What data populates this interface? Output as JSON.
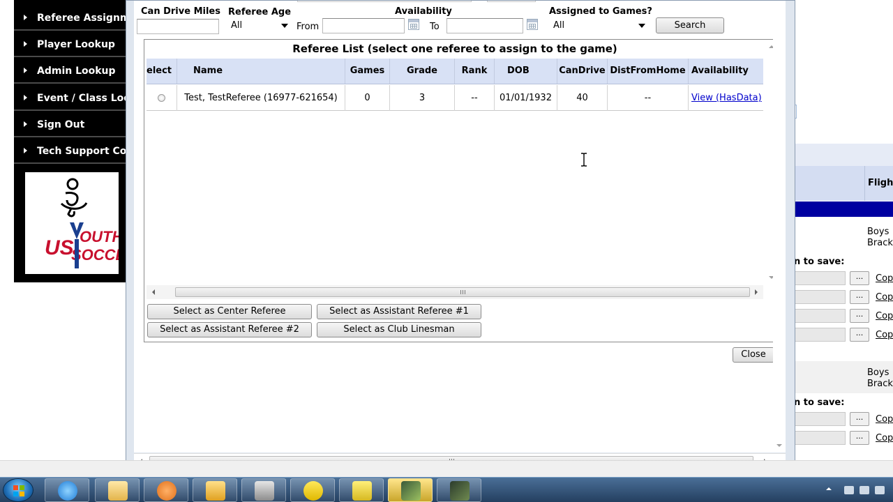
{
  "nav": {
    "items": [
      {
        "label": "Referee Assignme"
      },
      {
        "label": "Player Lookup"
      },
      {
        "label": "Admin Lookup"
      },
      {
        "label": "Event / Class Loo"
      },
      {
        "label": "Sign Out"
      },
      {
        "label": "Tech Support Cor"
      }
    ],
    "logo_text": "US YOUTH SOCCER"
  },
  "filters": {
    "can_drive_miles_label": "Can Drive Miles",
    "can_drive_miles_value": "",
    "referee_age_label": "Referee Age",
    "referee_age_value": "All",
    "availability_label": "Availability",
    "from_label": "From",
    "from_value": "",
    "to_label": "To",
    "to_value": "",
    "assigned_label": "Assigned to Games?",
    "assigned_value": "All",
    "search_button": "Search"
  },
  "grid": {
    "title": "Referee List (select one referee to assign to the game)",
    "columns": [
      "elect",
      "Name",
      "Games",
      "Grade",
      "Rank",
      "DOB",
      "CanDrive",
      "DistFromHome",
      "Availability"
    ],
    "rows": [
      {
        "name": "Test, TestReferee (16977-621654)",
        "games": "0",
        "grade": "3",
        "rank": "--",
        "dob": "01/01/1932",
        "can_drive": "40",
        "dist_from_home": "--",
        "availability": "View (HasData)"
      }
    ]
  },
  "actions": {
    "center": "Select as Center Referee",
    "ar1": "Select as Assistant Referee #1",
    "ar2": "Select as Assistant Referee #2",
    "linesman": "Select as Club Linesman",
    "close": "Close"
  },
  "right_page": {
    "header": "Fligh",
    "group1_line1": "Boys",
    "group1_line2": "Brack",
    "save_label_1": "n to save:",
    "group2_line1": "Boys",
    "group2_line2": "Brack",
    "save_label_2": "n to save:",
    "copy_link": "Cop",
    "dots": "..."
  },
  "colors": {
    "grid_header_bg": "#d8e1f5",
    "nav_bg": "#000000",
    "right_band": "#0000a0",
    "link": "#0000cc"
  }
}
